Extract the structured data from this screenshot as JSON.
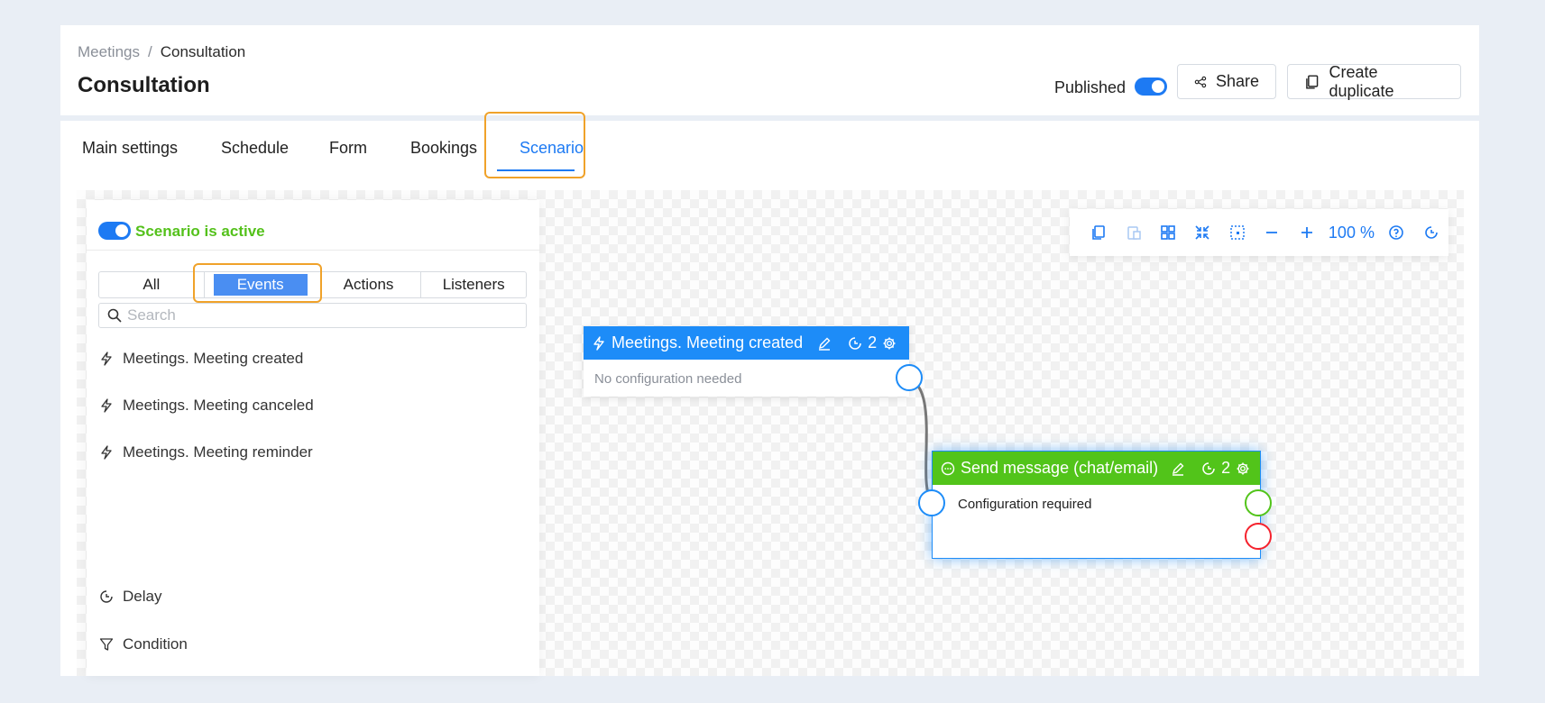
{
  "breadcrumb": {
    "parent": "Meetings",
    "separator": "/",
    "current": "Consultation"
  },
  "page_title": "Consultation",
  "header": {
    "published_label": "Published",
    "share_label": "Share",
    "duplicate_label": "Create duplicate"
  },
  "tabs": [
    {
      "label": "Main settings"
    },
    {
      "label": "Schedule"
    },
    {
      "label": "Form"
    },
    {
      "label": "Bookings"
    },
    {
      "label": "Scenario",
      "active": true
    }
  ],
  "side_panel": {
    "active_label": "Scenario is active",
    "filters": [
      "All",
      "Events",
      "Actions",
      "Listeners"
    ],
    "active_filter": "Events",
    "search_placeholder": "Search",
    "events": [
      "Meetings. Meeting created",
      "Meetings. Meeting canceled",
      "Meetings. Meeting reminder"
    ],
    "utilities": [
      "Delay",
      "Condition"
    ]
  },
  "toolbar": {
    "zoom": "100 %",
    "icons": [
      "copy-icon",
      "paste-icon",
      "grid-icon",
      "fit-screen-icon",
      "select-area-icon",
      "zoom-out-icon",
      "zoom-in-icon",
      "help-icon",
      "history-icon"
    ]
  },
  "nodes": {
    "event": {
      "title": "Meetings. Meeting created",
      "count": "2",
      "body": "No configuration needed",
      "color": "#1d8cf8"
    },
    "action": {
      "title": "Send message (chat/email)",
      "count": "2",
      "body": "Configuration required",
      "color": "#52c41a"
    }
  },
  "colors": {
    "accent": "#1d7af3",
    "success": "#52c41a",
    "error": "#f5222d",
    "highlight": "#f0a22a",
    "arrow": "#e8772a"
  }
}
